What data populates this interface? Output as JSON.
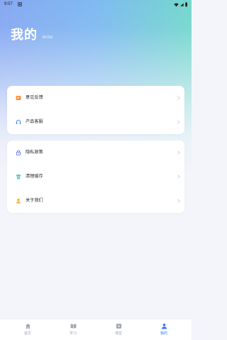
{
  "status_bar": {
    "time": "9:07",
    "left_icon": "notification-icon",
    "right_icons": [
      "wifi-icon",
      "signal-icon",
      "battery-icon"
    ]
  },
  "header": {
    "title": "我的",
    "subtitle": "MINE"
  },
  "menu_groups": [
    {
      "items": [
        {
          "label": "意见反馈",
          "icon": "feedback-icon",
          "icon_color": "#f7913d"
        },
        {
          "label": "产品客服",
          "icon": "headset-icon",
          "icon_color": "#3d82f6"
        }
      ]
    },
    {
      "items": [
        {
          "label": "隐私政策",
          "icon": "privacy-lock-icon",
          "icon_color": "#4e6cf4"
        },
        {
          "label": "清理缓存",
          "icon": "clear-cache-icon",
          "icon_color": "#21b9b1"
        },
        {
          "label": "关于我们",
          "icon": "about-us-icon",
          "icon_color": "#f5a623"
        }
      ]
    }
  ],
  "tab_bar": {
    "tabs": [
      {
        "label": "首页",
        "icon": "home-icon",
        "active": false
      },
      {
        "label": "学习",
        "icon": "book-icon",
        "active": false
      },
      {
        "label": "课堂",
        "icon": "play-icon",
        "active": false
      },
      {
        "label": "我的",
        "icon": "user-icon",
        "active": true
      }
    ]
  },
  "theme": {
    "accent": "#3a7bf6",
    "inactive": "#a3a8b2",
    "gradient_left": "#86a8f2",
    "gradient_mid": "#7fbaf1",
    "gradient_right": "#74d8cd",
    "page_background": "#f4f5fb"
  }
}
